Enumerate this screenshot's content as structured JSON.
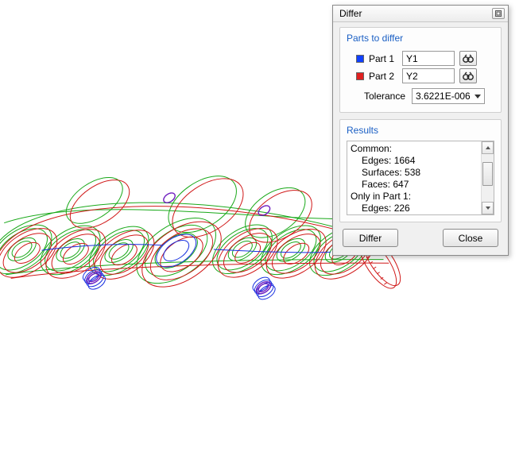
{
  "dialog": {
    "title": "Differ",
    "parts_group_title": "Parts to differ",
    "part1_label": "Part 1",
    "part2_label": "Part 2",
    "part1_value": "Y1",
    "part2_value": "Y2",
    "tolerance_label": "Tolerance",
    "tolerance_value": "3.6221E-006",
    "results_title": "Results",
    "results": {
      "common_label": "Common:",
      "edges_label": "Edges:",
      "edges_value": "1664",
      "surfaces_label": "Surfaces:",
      "surfaces_value": "538",
      "faces_label": "Faces:",
      "faces_value": "647",
      "only_part1_label": "Only in Part 1:",
      "only_edges_label": "Edges:",
      "only_edges_value": "226"
    },
    "differ_btn": "Differ",
    "close_btn": "Close"
  },
  "colors": {
    "part1": "#1040ff",
    "part2": "#e02020"
  }
}
